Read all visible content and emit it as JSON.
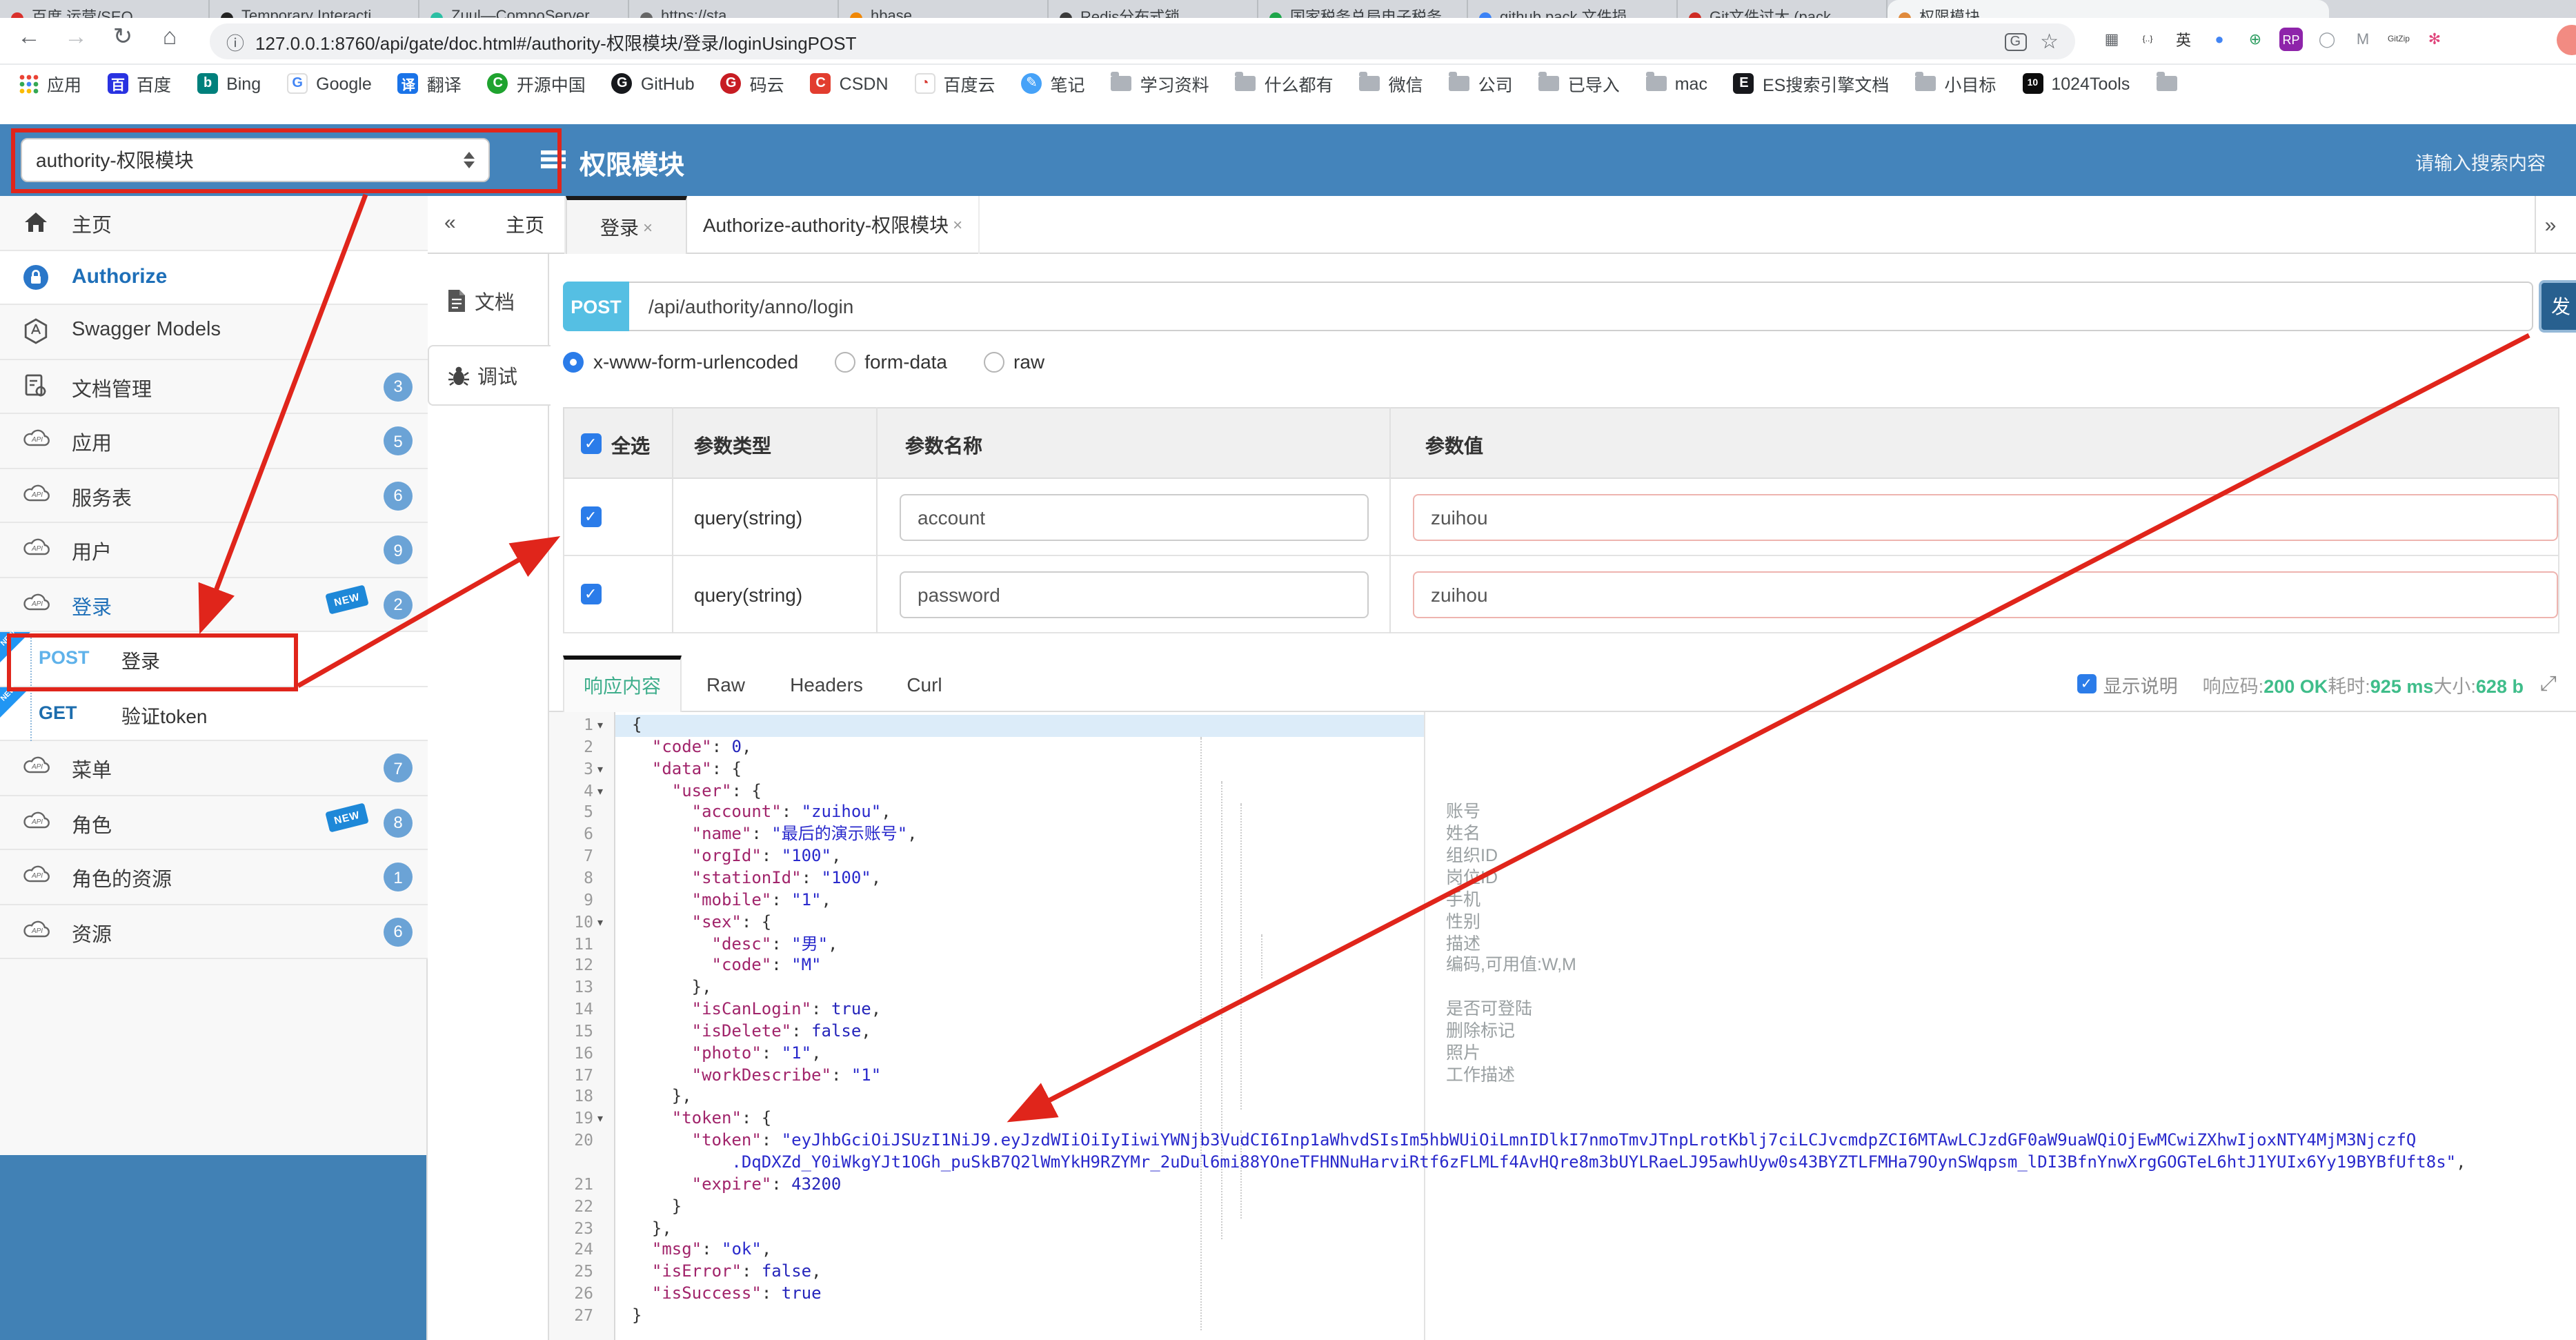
{
  "browser": {
    "tabs": [
      {
        "label": "百度 运营/SEO…",
        "color": "#d9302c"
      },
      {
        "label": "Temporary Interacti…",
        "color": "#222222"
      },
      {
        "label": "Zuul—CompoServer…",
        "color": "#2bbfa3"
      },
      {
        "label": "https://sta…",
        "color": "#666666"
      },
      {
        "label": "hbase",
        "color": "#f08705"
      },
      {
        "label": "Redis分布式锁…",
        "color": "#3a3a3a"
      },
      {
        "label": "国家税务总局电子税务…",
        "color": "#1ea64a"
      },
      {
        "label": "github pack 文件损…",
        "color": "#3b82f6"
      },
      {
        "label": "Git文件过大 (pack…",
        "color": "#cf2b24"
      },
      {
        "label": "权限模块",
        "color": "#e08a3c",
        "active": true
      }
    ],
    "toolbar": {
      "url": "127.0.0.1:8760/api/gate/doc.html#/authority-权限模块/登录/loginUsingPOST",
      "back": "←",
      "forward": "→",
      "reload": "↻",
      "home": "⌂",
      "info": "ⓘ",
      "star": "☆",
      "translate": "G"
    },
    "extensions": [
      {
        "glyph": "▦",
        "bg": "#ffffff",
        "fg": "#5f6368"
      },
      {
        "glyph": "{..}",
        "bg": "#ffffff",
        "fg": "#333333"
      },
      {
        "glyph": "英",
        "bg": "#ffffff",
        "fg": "#333333"
      },
      {
        "glyph": "●",
        "bg": "#ffffff",
        "fg": "#4285f4"
      },
      {
        "glyph": "⊕",
        "bg": "#ffffff",
        "fg": "#2e9e62"
      },
      {
        "glyph": "RP",
        "bg": "#8e24aa",
        "fg": "#ffffff"
      },
      {
        "glyph": "◯",
        "bg": "#ffffff",
        "fg": "#9aa0a6"
      },
      {
        "glyph": "M",
        "bg": "#ffffff",
        "fg": "#8b9096"
      },
      {
        "glyph": "GitZip",
        "bg": "#ffffff",
        "fg": "#444444"
      },
      {
        "glyph": "✻",
        "bg": "#ffffff",
        "fg": "#e0457b"
      }
    ],
    "bookmarks": [
      {
        "label": "应用",
        "type": "apps"
      },
      {
        "label": "百度",
        "bg": "#2932e1",
        "glyph": "百",
        "fg": "#ffffff"
      },
      {
        "label": "Bing",
        "bg": "#00807c",
        "glyph": "b",
        "fg": "#ffffff"
      },
      {
        "label": "Google",
        "bg": "#ffffff",
        "glyph": "G",
        "fg": "#4285f4",
        "border": true
      },
      {
        "label": "翻译",
        "bg": "#1a73e8",
        "glyph": "译",
        "fg": "#ffffff"
      },
      {
        "label": "开源中国",
        "bg": "#1fa32f",
        "glyph": "C",
        "fg": "#ffffff",
        "round": true
      },
      {
        "label": "GitHub",
        "bg": "#16181c",
        "glyph": "G",
        "fg": "#ffffff",
        "round": true
      },
      {
        "label": "码云",
        "bg": "#c71d23",
        "glyph": "G",
        "fg": "#ffffff",
        "round": true
      },
      {
        "label": "CSDN",
        "bg": "#e23d2f",
        "glyph": "C",
        "fg": "#ffffff"
      },
      {
        "label": "百度云",
        "bg": "#ffffff",
        "glyph": "◔",
        "fg": "#d6332c",
        "border": true
      },
      {
        "label": "笔记",
        "bg": "#46a2f8",
        "glyph": "✎",
        "fg": "#ffffff",
        "round": true
      },
      {
        "label": "学习资料",
        "type": "folder"
      },
      {
        "label": "什么都有",
        "type": "folder"
      },
      {
        "label": "微信",
        "type": "folder"
      },
      {
        "label": "公司",
        "type": "folder"
      },
      {
        "label": "已导入",
        "type": "folder"
      },
      {
        "label": "mac",
        "type": "folder"
      },
      {
        "label": "ES搜索引擎文档",
        "bg": "#17181c",
        "glyph": "E",
        "fg": "#ffffff"
      },
      {
        "label": "小目标",
        "type": "folder"
      },
      {
        "label": "1024Tools",
        "bg": "#0c0c0c",
        "glyph": "10",
        "fg": "#ffffff"
      },
      {
        "label": "",
        "type": "folder"
      }
    ]
  },
  "app_header": {
    "module_select_value": "authority-权限模块",
    "title": "权限模块",
    "search_placeholder": "请输入搜索内容"
  },
  "sidebar": {
    "items": [
      {
        "label": "主页",
        "icon": "home"
      },
      {
        "label": "Authorize",
        "icon": "lock",
        "style": "auth",
        "white": true
      },
      {
        "label": "Swagger Models",
        "icon": "hex"
      },
      {
        "label": "文档管理",
        "icon": "docgear",
        "badge": "3"
      },
      {
        "label": "应用",
        "icon": "cloud",
        "badge": "5"
      },
      {
        "label": "服务表",
        "icon": "cloud",
        "badge": "6"
      },
      {
        "label": "用户",
        "icon": "cloud",
        "badge": "9"
      },
      {
        "label": "登录",
        "icon": "cloud",
        "badge": "2",
        "new_tag": true,
        "selected": true
      },
      {
        "type": "api",
        "method": "POST",
        "method_color": "#5fb2ea",
        "label": "登录",
        "new_ribbon": true,
        "white": true
      },
      {
        "type": "api",
        "method": "GET",
        "method_color": "#1d6dad",
        "label": "验证token",
        "new_ribbon": true,
        "white": true
      },
      {
        "label": "菜单",
        "icon": "cloud",
        "badge": "7"
      },
      {
        "label": "角色",
        "icon": "cloud",
        "badge": "8",
        "new_tag": true
      },
      {
        "label": "角色的资源",
        "icon": "cloud",
        "badge": "1"
      },
      {
        "label": "资源",
        "icon": "cloud",
        "badge": "6"
      }
    ]
  },
  "tabs_bar": {
    "collapse_left": "«",
    "collapse_right": "»",
    "tabs": [
      {
        "label": "主页",
        "closable": false
      },
      {
        "label": "登录",
        "closable": true,
        "active": true
      },
      {
        "label": "Authorize-authority-权限模块",
        "closable": true
      }
    ]
  },
  "subnav": [
    {
      "label": "文档",
      "icon": "doc"
    },
    {
      "label": "调试",
      "icon": "bug",
      "active": true
    }
  ],
  "request": {
    "method": "POST",
    "path": "/api/authority/anno/login",
    "send_label": "发",
    "content_types": [
      "x-www-form-urlencoded",
      "form-data",
      "raw"
    ],
    "selected_content_type": "x-www-form-urlencoded",
    "params_table": {
      "headers": [
        "全选",
        "参数类型",
        "参数名称",
        "参数值"
      ],
      "rows": [
        {
          "checked": true,
          "type": "query(string)",
          "name": "account",
          "value": "zuihou"
        },
        {
          "checked": true,
          "type": "query(string)",
          "name": "password",
          "value": "zuihou"
        }
      ]
    }
  },
  "response": {
    "tabs": [
      "响应内容",
      "Raw",
      "Headers",
      "Curl"
    ],
    "active_tab": "响应内容",
    "show_desc_label": "显示说明",
    "meta": [
      {
        "label": "响应码:",
        "value": "200 OK"
      },
      {
        "label": "耗时:",
        "value": "925 ms"
      },
      {
        "label": "大小:",
        "value": "628 b"
      }
    ],
    "json_lines": [
      {
        "n": "1",
        "fold": true,
        "indent": 0,
        "hl": true,
        "segs": [
          [
            "p",
            "{"
          ]
        ]
      },
      {
        "n": "2",
        "indent": 1,
        "segs": [
          [
            "k",
            "\"code\""
          ],
          [
            "p",
            ": "
          ],
          [
            "n",
            "0"
          ],
          [
            "p",
            ","
          ]
        ]
      },
      {
        "n": "3",
        "fold": true,
        "indent": 1,
        "segs": [
          [
            "k",
            "\"data\""
          ],
          [
            "p",
            ": {"
          ]
        ]
      },
      {
        "n": "4",
        "fold": true,
        "indent": 2,
        "segs": [
          [
            "k",
            "\"user\""
          ],
          [
            "p",
            ": {"
          ]
        ]
      },
      {
        "n": "5",
        "indent": 3,
        "segs": [
          [
            "k",
            "\"account\""
          ],
          [
            "p",
            ": "
          ],
          [
            "s",
            "\"zuihou\""
          ],
          [
            "p",
            ","
          ]
        ]
      },
      {
        "n": "6",
        "indent": 3,
        "segs": [
          [
            "k",
            "\"name\""
          ],
          [
            "p",
            ": "
          ],
          [
            "s",
            "\"最后的演示账号\""
          ],
          [
            "p",
            ","
          ]
        ]
      },
      {
        "n": "7",
        "indent": 3,
        "segs": [
          [
            "k",
            "\"orgId\""
          ],
          [
            "p",
            ": "
          ],
          [
            "s",
            "\"100\""
          ],
          [
            "p",
            ","
          ]
        ]
      },
      {
        "n": "8",
        "indent": 3,
        "segs": [
          [
            "k",
            "\"stationId\""
          ],
          [
            "p",
            ": "
          ],
          [
            "s",
            "\"100\""
          ],
          [
            "p",
            ","
          ]
        ]
      },
      {
        "n": "9",
        "indent": 3,
        "segs": [
          [
            "k",
            "\"mobile\""
          ],
          [
            "p",
            ": "
          ],
          [
            "s",
            "\"1\""
          ],
          [
            "p",
            ","
          ]
        ]
      },
      {
        "n": "10",
        "fold": true,
        "indent": 3,
        "segs": [
          [
            "k",
            "\"sex\""
          ],
          [
            "p",
            ": {"
          ]
        ]
      },
      {
        "n": "11",
        "indent": 4,
        "segs": [
          [
            "k",
            "\"desc\""
          ],
          [
            "p",
            ": "
          ],
          [
            "s",
            "\"男\""
          ],
          [
            "p",
            ","
          ]
        ]
      },
      {
        "n": "12",
        "indent": 4,
        "segs": [
          [
            "k",
            "\"code\""
          ],
          [
            "p",
            ": "
          ],
          [
            "s",
            "\"M\""
          ]
        ]
      },
      {
        "n": "13",
        "indent": 3,
        "segs": [
          [
            "p",
            "},"
          ]
        ]
      },
      {
        "n": "14",
        "indent": 3,
        "segs": [
          [
            "k",
            "\"isCanLogin\""
          ],
          [
            "p",
            ": "
          ],
          [
            "n",
            "true"
          ],
          [
            "p",
            ","
          ]
        ]
      },
      {
        "n": "15",
        "indent": 3,
        "segs": [
          [
            "k",
            "\"isDelete\""
          ],
          [
            "p",
            ": "
          ],
          [
            "n",
            "false"
          ],
          [
            "p",
            ","
          ]
        ]
      },
      {
        "n": "16",
        "indent": 3,
        "segs": [
          [
            "k",
            "\"photo\""
          ],
          [
            "p",
            ": "
          ],
          [
            "s",
            "\"1\""
          ],
          [
            "p",
            ","
          ]
        ]
      },
      {
        "n": "17",
        "indent": 3,
        "segs": [
          [
            "k",
            "\"workDescribe\""
          ],
          [
            "p",
            ": "
          ],
          [
            "s",
            "\"1\""
          ]
        ]
      },
      {
        "n": "18",
        "indent": 2,
        "segs": [
          [
            "p",
            "},"
          ]
        ]
      },
      {
        "n": "19",
        "fold": true,
        "indent": 2,
        "segs": [
          [
            "k",
            "\"token\""
          ],
          [
            "p",
            ": {"
          ]
        ]
      },
      {
        "n": "20",
        "indent": 3,
        "segs": [
          [
            "k",
            "\"token\""
          ],
          [
            "p",
            ": "
          ],
          [
            "s",
            "\"eyJhbGciOiJSUzI1NiJ9.eyJzdWIiOiIyIiwiYWNjb3VudCI6Inp1aWhvdSIsIm5hbWUiOiLmnIDlkI7nmoTmvJTnpLrotKblj7ciLCJvcmdpZCI6MTAwLCJzdGF0aW9uaWQiOjEwMCwiZXhwIjoxNTY4MjM3NjczfQ"
          ]
        ]
      },
      {
        "n": "",
        "cont": true,
        "indent": 0,
        "pad": 10,
        "segs": [
          [
            "s",
            ".DqDXZd_Y0iWkgYJt1OGh_puSkB7Q2lWmYkH9RZYMr_2uDul6mi88YOneTFHNNuHarviRtf6zFLMLf4AvHQre8m3bUYLRaeLJ95awhUyw0s43BYZTLFMHa79OynSWqpsm_lDI3BfnYnwXrgGOGTeL6htJ1YUIx6Yy19BYBfUft8s\""
          ],
          [
            "p",
            ","
          ]
        ]
      },
      {
        "n": "21",
        "indent": 3,
        "segs": [
          [
            "k",
            "\"expire\""
          ],
          [
            "p",
            ": "
          ],
          [
            "n",
            "43200"
          ]
        ]
      },
      {
        "n": "22",
        "indent": 2,
        "segs": [
          [
            "p",
            "}"
          ]
        ]
      },
      {
        "n": "23",
        "indent": 1,
        "segs": [
          [
            "p",
            "},"
          ]
        ]
      },
      {
        "n": "24",
        "indent": 1,
        "segs": [
          [
            "k",
            "\"msg\""
          ],
          [
            "p",
            ": "
          ],
          [
            "s",
            "\"ok\""
          ],
          [
            "p",
            ","
          ]
        ]
      },
      {
        "n": "25",
        "indent": 1,
        "segs": [
          [
            "k",
            "\"isError\""
          ],
          [
            "p",
            ": "
          ],
          [
            "n",
            "false"
          ],
          [
            "p",
            ","
          ]
        ]
      },
      {
        "n": "26",
        "indent": 1,
        "segs": [
          [
            "k",
            "\"isSuccess\""
          ],
          [
            "p",
            ": "
          ],
          [
            "n",
            "true"
          ]
        ]
      },
      {
        "n": "27",
        "indent": 0,
        "segs": [
          [
            "p",
            "}"
          ]
        ]
      }
    ],
    "annotations": [
      {
        "line": 5,
        "text": "账号"
      },
      {
        "line": 6,
        "text": "姓名"
      },
      {
        "line": 7,
        "text": "组织ID"
      },
      {
        "line": 8,
        "text": "岗位ID"
      },
      {
        "line": 9,
        "text": "手机"
      },
      {
        "line": 10,
        "text": "性别"
      },
      {
        "line": 11,
        "text": "描述"
      },
      {
        "line": 12,
        "text": "编码,可用值:W,M"
      },
      {
        "line": 14,
        "text": "是否可登陆"
      },
      {
        "line": 15,
        "text": "删除标记"
      },
      {
        "line": 16,
        "text": "照片"
      },
      {
        "line": 17,
        "text": "工作描述"
      }
    ]
  },
  "colors": {
    "header_blue": "#4484bb",
    "sidebar_footer_blue": "#4181b5",
    "post_badge": "#55bfe3",
    "send_button": "#28608f",
    "success_green": "#3fbd8a",
    "annotation_red": "#e0251b",
    "new_badge_blue": "#2196f3",
    "json_key": "#a1246b",
    "json_value": "#2929cc"
  }
}
